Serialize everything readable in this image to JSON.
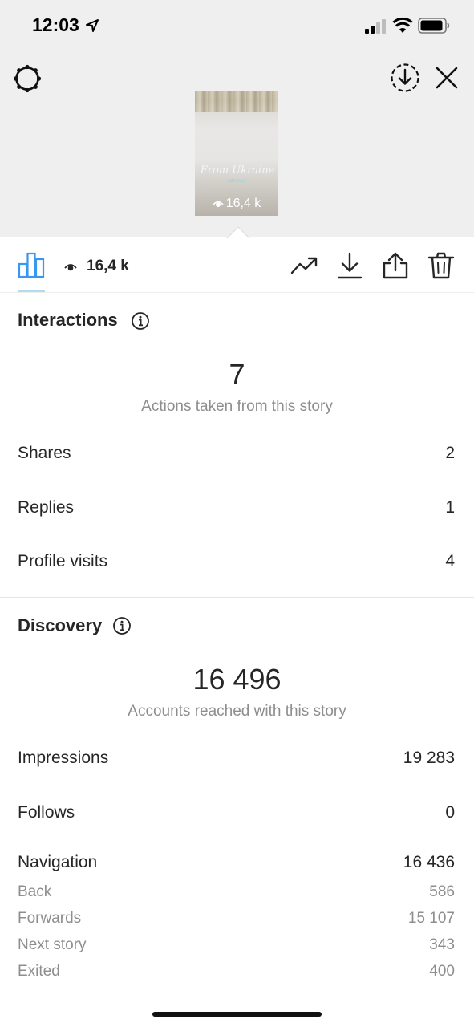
{
  "status_bar": {
    "time": "12:03"
  },
  "story": {
    "thumb_text": "From Ukraine",
    "thumb_subtext": "with love",
    "views": "16,4 k"
  },
  "toolbar": {
    "views": "16,4 k"
  },
  "interactions": {
    "title": "Interactions",
    "total": "7",
    "caption": "Actions taken from this story",
    "rows": [
      {
        "label": "Shares",
        "value": "2"
      },
      {
        "label": "Replies",
        "value": "1"
      },
      {
        "label": "Profile visits",
        "value": "4"
      }
    ]
  },
  "discovery": {
    "title": "Discovery",
    "total": "16 496",
    "caption": "Accounts reached with this story",
    "rows": [
      {
        "label": "Impressions",
        "value": "19 283"
      },
      {
        "label": "Follows",
        "value": "0"
      }
    ],
    "navigation": {
      "label": "Navigation",
      "value": "16 436",
      "items": [
        {
          "label": "Back",
          "value": "586"
        },
        {
          "label": "Forwards",
          "value": "15 107"
        },
        {
          "label": "Next story",
          "value": "343"
        },
        {
          "label": "Exited",
          "value": "400"
        }
      ]
    }
  },
  "colors": {
    "accent": "#3897f0",
    "tab_active": "#0095f6",
    "muted": "#8e8e8e"
  }
}
